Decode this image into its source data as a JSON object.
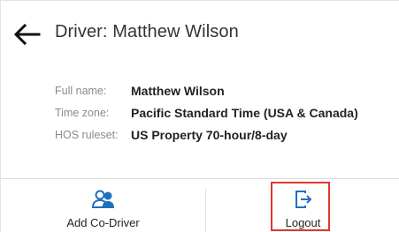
{
  "header": {
    "title": "Driver: Matthew Wilson",
    "back_icon": "arrow-left-icon"
  },
  "details": [
    {
      "label": "Full name:",
      "value": "Matthew Wilson"
    },
    {
      "label": "Time zone:",
      "value": "Pacific Standard Time (USA & Canada)"
    },
    {
      "label": "HOS ruleset:",
      "value": "US Property 70-hour/8-day"
    }
  ],
  "actions": {
    "add_co_driver": {
      "label": "Add Co-Driver",
      "icon": "add-user-icon"
    },
    "logout": {
      "label": "Logout",
      "icon": "logout-icon"
    }
  },
  "colors": {
    "accent": "#1f6fbf",
    "highlight": "#e0382c"
  }
}
